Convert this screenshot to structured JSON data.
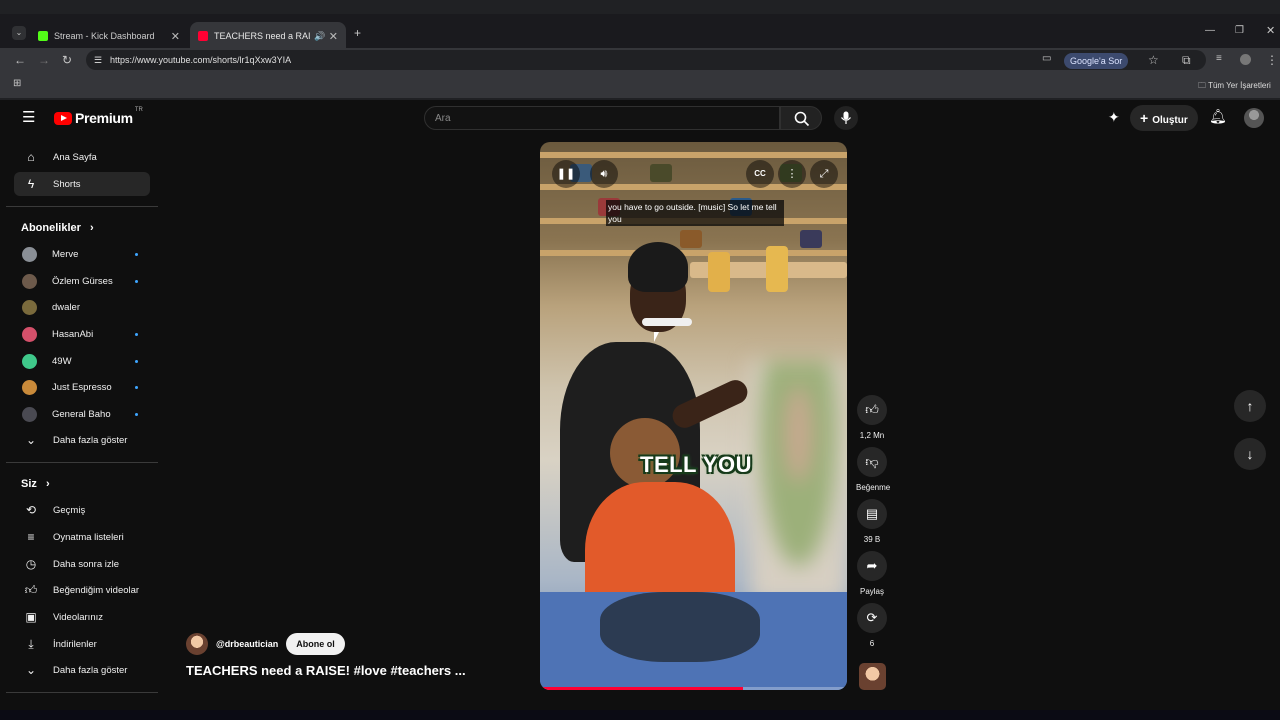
{
  "browser": {
    "tabs": [
      {
        "title": "Stream - Kick Dashboard",
        "active": false
      },
      {
        "title": "TEACHERS need a RAISE! #l",
        "active": true
      }
    ],
    "url": "https://www.youtube.com/shorts/lr1qXxw3YIA",
    "google_sor": "Google'a Sor",
    "bookmarks_all": "Tüm Yer İşaretleri"
  },
  "youtube": {
    "logo_text": "Premium",
    "logo_country": "TR",
    "search_placeholder": "Ara",
    "create_label": "Oluştur",
    "nav": [
      {
        "label": "Ana Sayfa",
        "icon": "home-icon"
      },
      {
        "label": "Shorts",
        "icon": "shorts-icon",
        "active": true
      }
    ],
    "subscriptions_title": "Abonelikler",
    "subscriptions": [
      {
        "name": "Merve",
        "color": "#8a8f96",
        "new": true
      },
      {
        "name": "Özlem Gürses",
        "color": "#6d5a4b",
        "new": true
      },
      {
        "name": "dwaler",
        "color": "#7a6a3c",
        "new": false
      },
      {
        "name": "HasanAbi",
        "color": "#d4506a",
        "new": true
      },
      {
        "name": "49W",
        "color": "#3fc88a",
        "new": true
      },
      {
        "name": "Just Espresso",
        "color": "#c98a3a",
        "new": true
      },
      {
        "name": "General Baho",
        "color": "#4a4a52",
        "new": true
      }
    ],
    "show_more_1": "Daha fazla göster",
    "you_title": "Siz",
    "you_items": [
      {
        "label": "Geçmiş",
        "icon": "history-icon"
      },
      {
        "label": "Oynatma listeleri",
        "icon": "playlists-icon"
      },
      {
        "label": "Daha sonra izle",
        "icon": "watch-later-icon"
      },
      {
        "label": "Beğendiğim videolar",
        "icon": "liked-icon"
      },
      {
        "label": "Videolarınız",
        "icon": "your-videos-icon"
      },
      {
        "label": "İndirilenler",
        "icon": "downloads-icon"
      }
    ],
    "show_more_2": "Daha fazla göster",
    "video": {
      "caption": "you have to go outside. [music] So let me tell you",
      "overlay_text": "TELL YOU",
      "progress": 0.66
    },
    "actions": {
      "likes": "1,2 Mn",
      "dislike": "Beğenme",
      "comments": "39 B",
      "share": "Paylaş",
      "remix": "6"
    },
    "channel_handle": "@drbeautician",
    "subscribe_label": "Abone ol",
    "video_title": "TEACHERS need a RAISE! #love #teachers ..."
  }
}
